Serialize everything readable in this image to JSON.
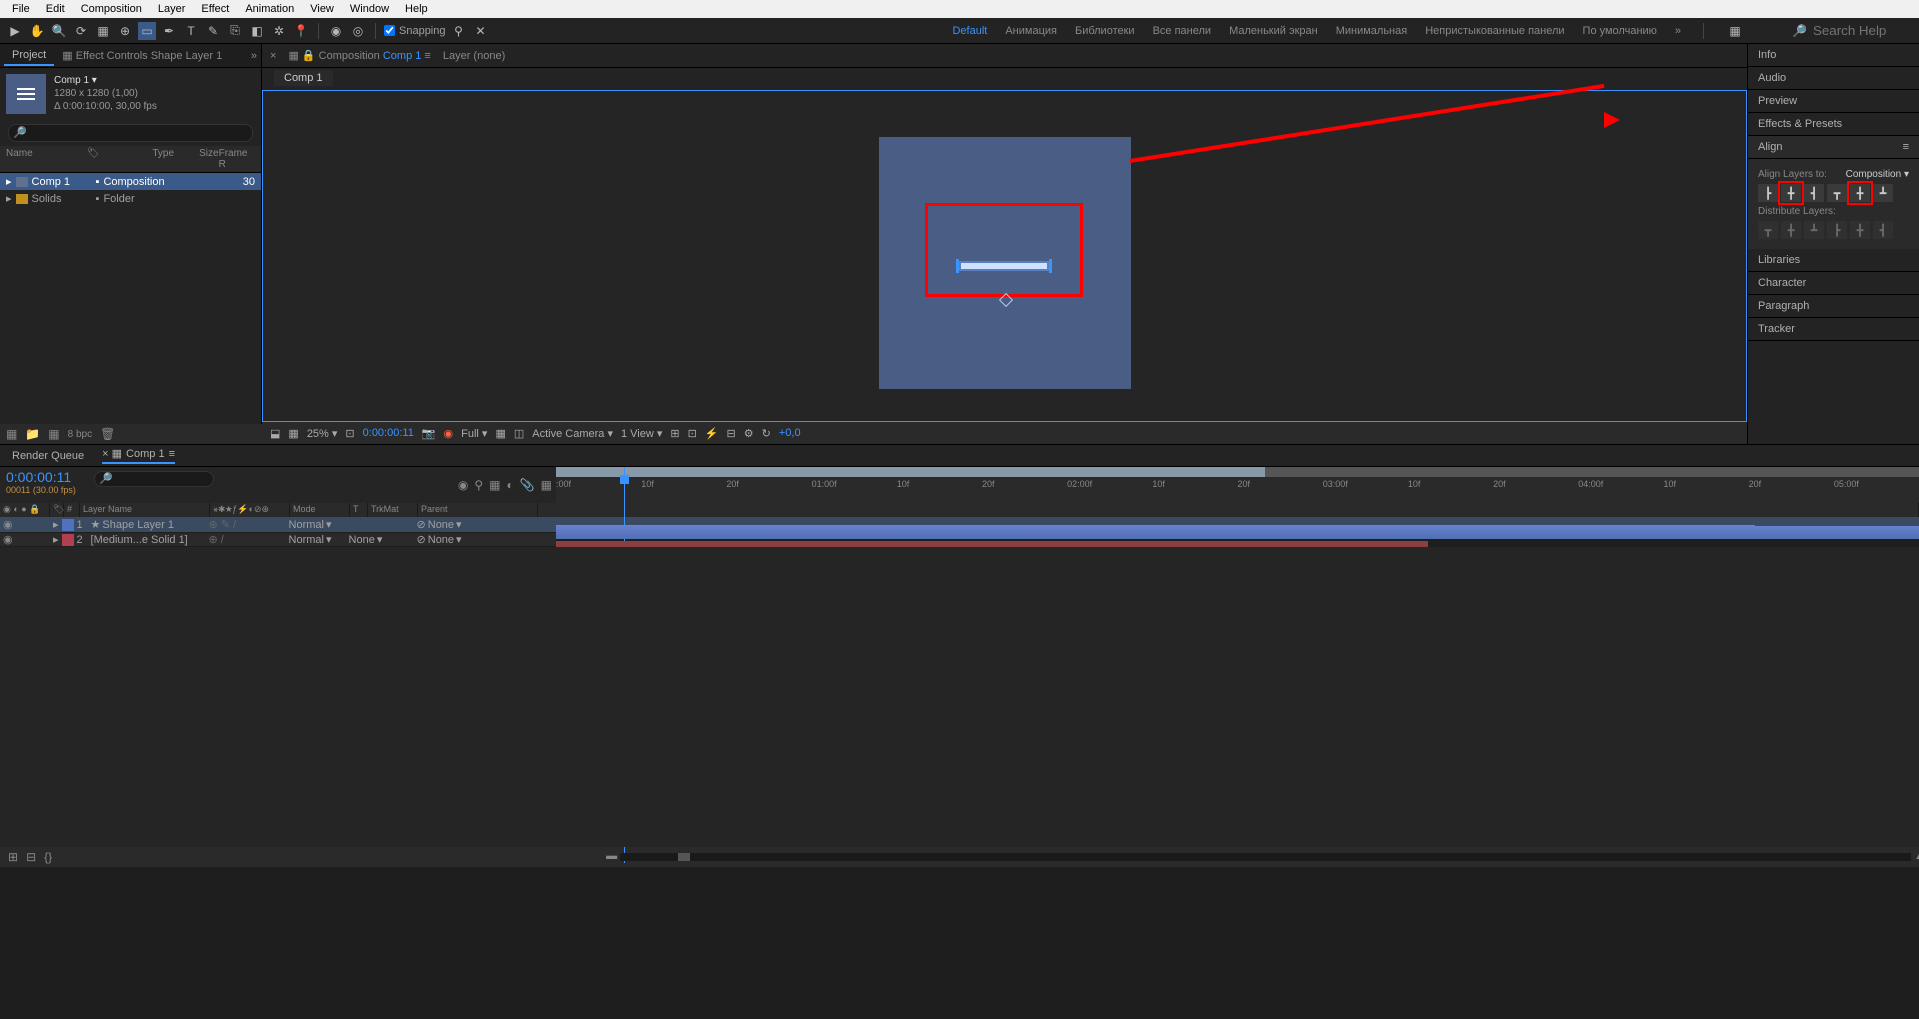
{
  "menu": [
    "File",
    "Edit",
    "Composition",
    "Layer",
    "Effect",
    "Animation",
    "View",
    "Window",
    "Help"
  ],
  "toolbar": {
    "snapping": "Snapping"
  },
  "workspaces": [
    "Default",
    "Анимация",
    "Библиотеки",
    "Все панели",
    "Маленький экран",
    "Минимальная",
    "Непристыкованные панели",
    "По умолчанию"
  ],
  "search_placeholder": "Search Help",
  "project": {
    "tab": "Project",
    "tab2": "Effect Controls Shape Layer 1",
    "comp_name": "Comp 1 ▾",
    "comp_dims": "1280 x 1280 (1,00)",
    "comp_dur": "Δ 0:00:10:00, 30,00 fps",
    "cols": [
      "Name",
      "Type",
      "Size",
      "Frame R"
    ],
    "items": [
      {
        "name": "Comp 1",
        "type": "Composition",
        "extra": "30"
      },
      {
        "name": "Solids",
        "type": "Folder",
        "extra": ""
      }
    ],
    "bpc": "8 bpc"
  },
  "comp": {
    "breadcrumb_label": "Composition",
    "breadcrumb_link": "Comp 1",
    "layer_none": "Layer (none)",
    "subtab": "Comp 1",
    "zoom": "25%",
    "timecode": "0:00:00:11",
    "res": "Full",
    "camera": "Active Camera",
    "views": "1 View",
    "exposure": "+0,0"
  },
  "right": {
    "panels": [
      "Info",
      "Audio",
      "Preview",
      "Effects & Presets",
      "Align",
      "Libraries",
      "Character",
      "Paragraph",
      "Tracker"
    ],
    "align_label": "Align Layers to:",
    "align_target": "Composition",
    "distribute_label": "Distribute Layers:"
  },
  "timeline": {
    "tabs": [
      "Render Queue",
      "Comp 1"
    ],
    "timecode": "0:00:00:11",
    "timecode_sub": "00011 (30.00 fps)",
    "col_headers": [
      "#",
      "Layer Name",
      "Mode",
      "T",
      "TrkMat",
      "Parent"
    ],
    "ticks": [
      ":00f",
      "10f",
      "20f",
      "01:00f",
      "10f",
      "20f",
      "02:00f",
      "10f",
      "20f",
      "03:00f",
      "10f",
      "20f",
      "04:00f",
      "10f",
      "20f",
      "05:00f"
    ],
    "layers": [
      {
        "num": "1",
        "name": "Shape Layer 1",
        "color": "#5070c0",
        "chip2": "#b04050",
        "mode": "Normal",
        "trkmat": "",
        "parent": "None"
      },
      {
        "num": "2",
        "name": "[Medium...e Solid 1]",
        "color": "#b04050",
        "chip2": "#b04050",
        "mode": "Normal",
        "trkmat": "None",
        "parent": "None"
      }
    ]
  }
}
